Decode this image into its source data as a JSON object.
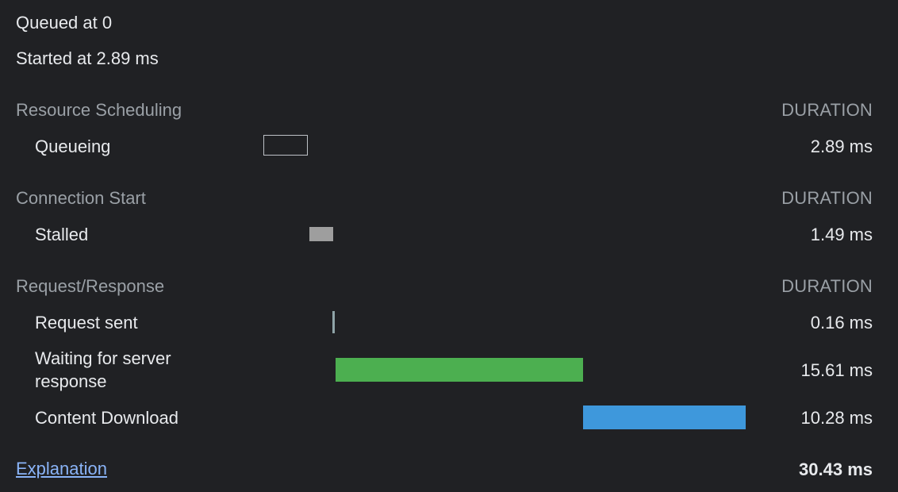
{
  "header": {
    "queued": "Queued at 0",
    "started": "Started at 2.89 ms"
  },
  "sections": [
    {
      "title": "Resource Scheduling",
      "duration_header": "DURATION",
      "rows": [
        {
          "label": "Queueing",
          "value": "2.89 ms",
          "bar_color": "#bdc1c6"
        }
      ]
    },
    {
      "title": "Connection Start",
      "duration_header": "DURATION",
      "rows": [
        {
          "label": "Stalled",
          "value": "1.49 ms",
          "bar_color": "#9e9e9e"
        }
      ]
    },
    {
      "title": "Request/Response",
      "duration_header": "DURATION",
      "rows": [
        {
          "label": "Request sent",
          "value": "0.16 ms",
          "bar_color": "#8fa4a8"
        },
        {
          "label_line1": "Waiting for server",
          "label_line2": "response",
          "value": "15.61 ms",
          "bar_color": "#4caf50"
        },
        {
          "label": "Content Download",
          "value": "10.28 ms",
          "bar_color": "#3e98dc"
        }
      ]
    }
  ],
  "footer": {
    "explanation_link": "Explanation",
    "total": "30.43 ms"
  }
}
